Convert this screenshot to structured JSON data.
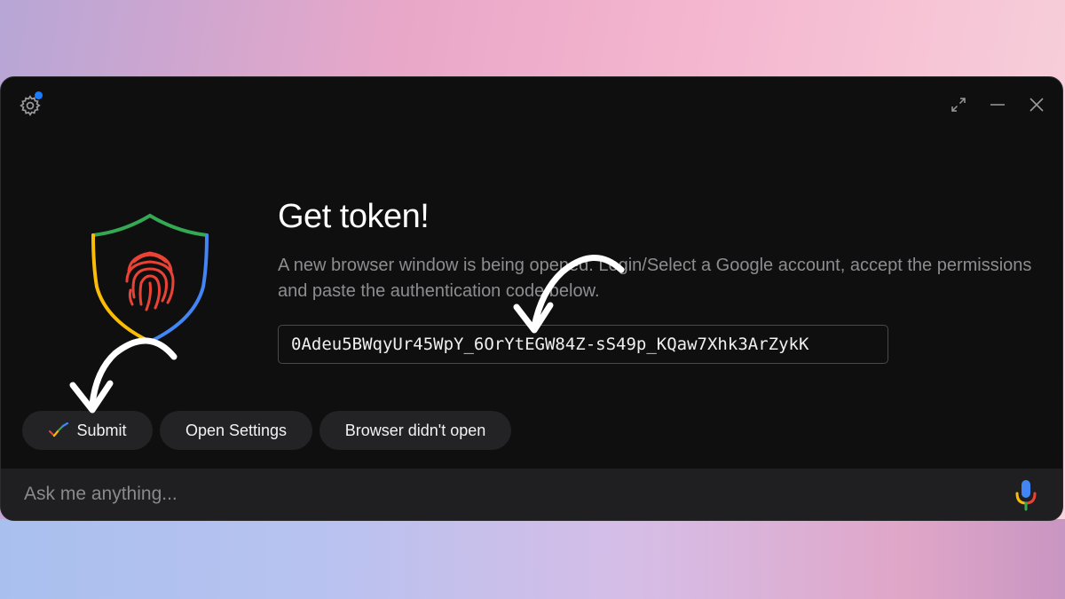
{
  "dialog": {
    "title": "Get token!",
    "description": "A new browser window is being opened. Login/Select a Google account, accept the permissions and paste the authentication code below.",
    "token_value": "0Adeu5BWqyUr45WpY_6OrYtEGW84Z-sS49p_KQaw7Xhk3ArZykK"
  },
  "buttons": {
    "submit": "Submit",
    "open_settings": "Open Settings",
    "browser_didnt_open": "Browser didn't open"
  },
  "ask_bar": {
    "placeholder": "Ask me anything..."
  },
  "icons": {
    "settings": "gear-icon",
    "expand": "expand-icon",
    "minimize": "minimize-icon",
    "close": "close-icon",
    "shield": "fingerprint-shield-icon",
    "check": "check-icon",
    "mic": "microphone-icon"
  },
  "colors": {
    "window_bg": "#0f0f10",
    "button_bg": "#232325",
    "notification_dot": "#1a7cff",
    "google_green": "#34a853",
    "google_blue": "#4285f4",
    "google_yellow": "#fbbc05",
    "google_red": "#ea4335"
  }
}
